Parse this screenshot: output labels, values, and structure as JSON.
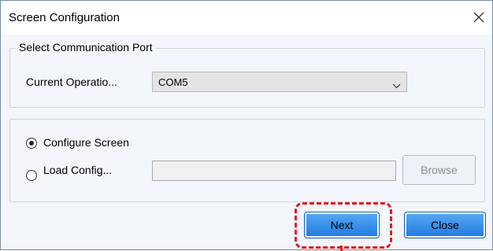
{
  "window": {
    "title": "Screen Configuration",
    "close_icon": "close-icon"
  },
  "port_group": {
    "legend": "Select Communication Port",
    "operation_label": "Current Operatio...",
    "operation_value": "COM5",
    "chevron_icon": "chevron-down-icon"
  },
  "config_group": {
    "option_configure": "Configure Screen",
    "option_configure_checked": true,
    "option_load": "Load Config...",
    "option_load_checked": false,
    "load_path_value": "",
    "browse_label": "Browse"
  },
  "footer": {
    "next_label": "Next",
    "close_label": "Close"
  },
  "colors": {
    "dialog_bg": "#f3f6fa",
    "primary_button": "#1e7be0",
    "highlight": "#dd1d22"
  }
}
